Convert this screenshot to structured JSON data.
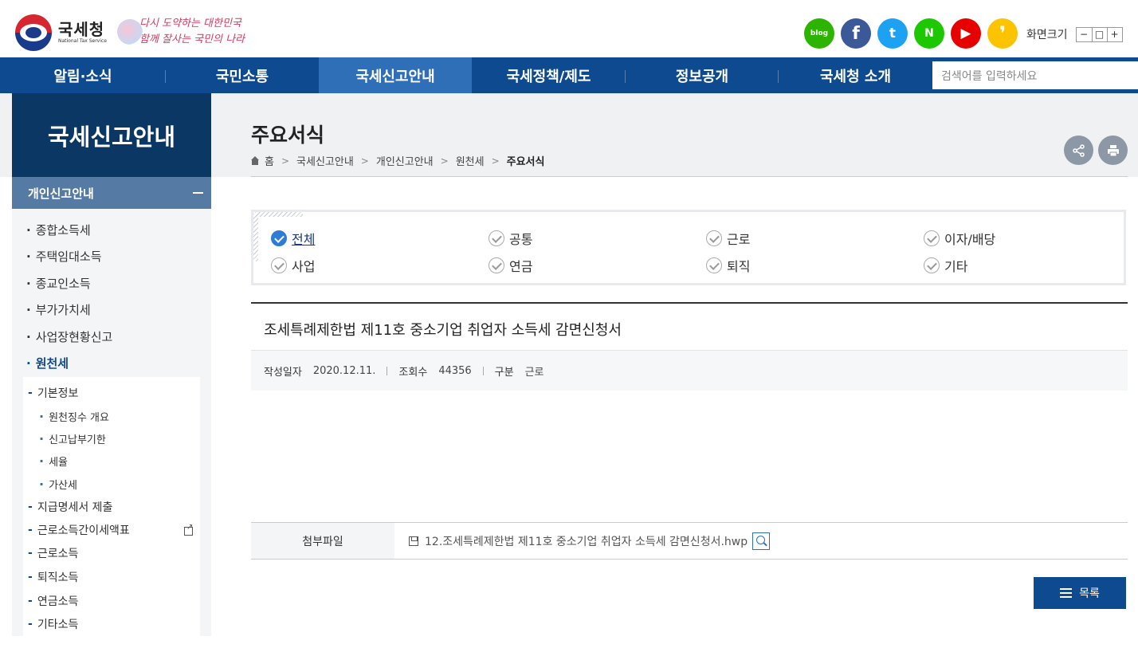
{
  "header": {
    "logo_ko": "국세청",
    "logo_en": "National Tax Service",
    "slogan_line1": "다시 도약하는 대한민국",
    "slogan_line2": "함께 잘사는 국민의 나라",
    "sns": [
      "blog",
      "f",
      "t",
      "N",
      "▶",
      "❜"
    ],
    "fontsize_label": "화면크기",
    "fontsize_buttons": [
      "−",
      "□",
      "+"
    ]
  },
  "gnb": {
    "items": [
      "알림·소식",
      "국민소통",
      "국세신고안내",
      "국세정책/제도",
      "정보공개",
      "국세청 소개"
    ],
    "search_placeholder": "검색어를 입력하세요"
  },
  "sidebar": {
    "title": "국세신고안내",
    "section": "개인신고안내",
    "menu": [
      "종합소득세",
      "주택임대소득",
      "종교인소득",
      "부가가치세",
      "사업장현황신고",
      "원천세"
    ],
    "submenu": {
      "basic": "기본정보",
      "basic_items": [
        "원천징수 개요",
        "신고납부기한",
        "세율",
        "가산세"
      ],
      "others": [
        "지급명세서 제출",
        "근로소득간이세액표",
        "근로소득",
        "퇴직소득",
        "연금소득",
        "기타소득"
      ]
    }
  },
  "main": {
    "page_title": "주요서식",
    "breadcrumb": [
      "홈",
      "국세신고안내",
      "개인신고안내",
      "원천세",
      "주요서식"
    ],
    "categories": [
      "전체",
      "공통",
      "근로",
      "이자/배당",
      "사업",
      "연금",
      "퇴직",
      "기타"
    ],
    "selected_category": "전체",
    "article": {
      "title": "조세특례제한법 제11호 중소기업 취업자 소득세 감면신청서",
      "date_label": "작성일자",
      "date": "2020.12.11.",
      "views_label": "조회수",
      "views": "44356",
      "type_label": "구분",
      "type": "근로",
      "attach_label": "첨부파일",
      "attach_file": "12.조세특례제한법 제11호 중소기업 취업자 소득세 감면신청서.hwp"
    },
    "list_button": "목록"
  },
  "colors": {
    "navy": "#0d4a8f",
    "sidebar_title": "#0b3765",
    "active_tab": "#2e6fb8"
  }
}
